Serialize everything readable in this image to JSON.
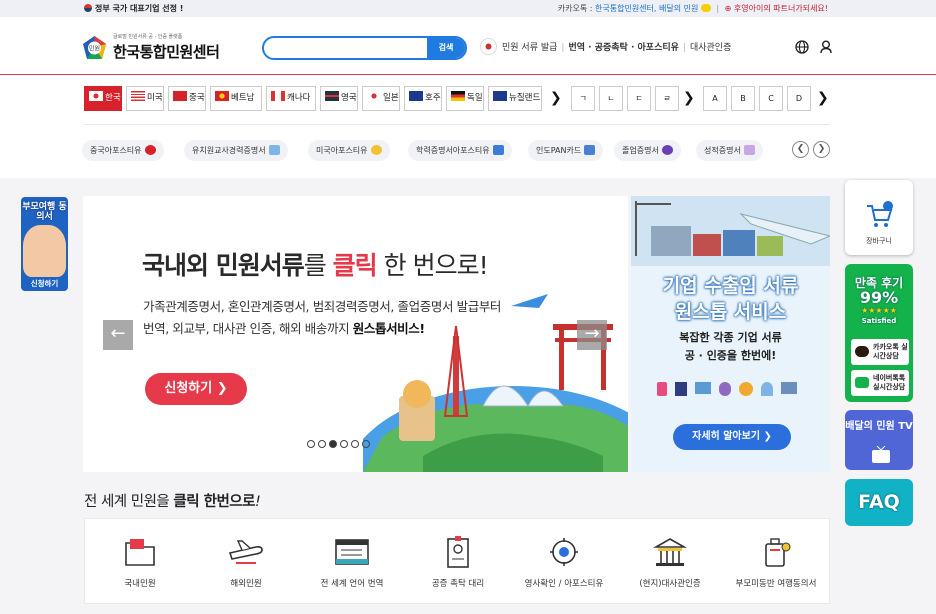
{
  "topbar": {
    "gov_badge": "정부 국가 대표기업 선정 !",
    "kakao_prefix": "카카오톡 : ",
    "kakao_link": "한국통합민원센터, 배달의 민원",
    "partner": "후영아이의 파트너가되세요!",
    "sep": "|"
  },
  "header": {
    "logo_sub": "글로벌 민원서류 공 · 인증 플랫폼",
    "logo_name": "한국통합민원센터",
    "logo_mark": "민원",
    "search": {
      "placeholder": "",
      "button": "검색"
    },
    "links": {
      "issue": "민원 서류 발급",
      "translate": "번역 · 공증촉탁 · 아포스티유",
      "embassy": "대사관인증"
    },
    "icons": [
      "globe-icon",
      "user-icon"
    ]
  },
  "country_tabs": [
    {
      "label": "한국",
      "active": true
    },
    {
      "label": "미국",
      "active": false
    },
    {
      "label": "중국",
      "active": false
    },
    {
      "label": "베트남",
      "active": false
    },
    {
      "label": "캐나다",
      "active": false
    },
    {
      "label": "영국",
      "active": false
    },
    {
      "label": "일본",
      "active": false
    },
    {
      "label": "호주",
      "active": false
    },
    {
      "label": "독일",
      "active": false
    },
    {
      "label": "뉴질랜드",
      "active": false
    }
  ],
  "consonant_tabs": [
    "ㄱ",
    "ㄴ",
    "ㄷ",
    "ㄹ"
  ],
  "alpha_tabs": [
    "A",
    "B",
    "C",
    "D"
  ],
  "arrows": {
    "next": "❯",
    "prev": "❮"
  },
  "chips": [
    "중국아포스티유",
    "유치원교사경력증명서",
    "미국아포스티유",
    "학력증명서아포스티유",
    "인도PAN카드",
    "졸업증명서",
    "성적증명서"
  ],
  "banner": {
    "headline_a": "국내외 민원서류",
    "headline_b": "를 ",
    "headline_c": "클릭",
    "headline_d": " 한 번으로!",
    "line1": "가족관계증명서, 혼인관계증명서, 범죄경력증명서, 졸업증명서 발급부터",
    "line2_a": "번역, 외교부, 대사관 인증, 해외 배송까지 ",
    "line2_b": "원스톱서비스!",
    "apply": "신청하기 ❯",
    "prev": "←",
    "next": "→",
    "slide_count": 6,
    "active_slide": 3
  },
  "side_banner": {
    "title1": "기업 수출입 서류",
    "title2": "원스톱 서비스",
    "sub1": "복잡한 각종 기업 서류",
    "sub2": "공 · 인증을 한번에!",
    "more": "자세히 알아보기 ❯"
  },
  "left_float": {
    "title": "부모여행 동의서",
    "button": "신청하기"
  },
  "right_float": {
    "cart": "장바구니",
    "satisfaction_title": "만족 후기",
    "satisfaction_value": "99%",
    "stars": "★★★★★",
    "satisfied": "Satisfied",
    "kakao": "카카오톡 실시간상담",
    "naver": "네이버톡톡 실시간상담",
    "tv": "배달의 민원 TV",
    "faq": "FAQ"
  },
  "section": {
    "title_a": "전 세계 민원을 ",
    "title_b": "클릭 한번으로",
    "title_c": "!"
  },
  "services": [
    {
      "label": "국내민원",
      "icon": "folder-icon"
    },
    {
      "label": "해외민원",
      "icon": "airplane-icon"
    },
    {
      "label": "전 세계 언어 번역",
      "icon": "document-icon"
    },
    {
      "label": "공증 촉탁 대리",
      "icon": "badge-icon"
    },
    {
      "label": "영사확인 / 아포스티유",
      "icon": "seal-icon"
    },
    {
      "label": "(현지)대사관인증",
      "icon": "embassy-icon"
    },
    {
      "label": "부모미동반 여행동의서",
      "icon": "luggage-icon"
    }
  ],
  "colors": {
    "brand_red": "#d8222b",
    "accent_blue": "#1f7be0",
    "cta_red": "#e63a4b"
  }
}
